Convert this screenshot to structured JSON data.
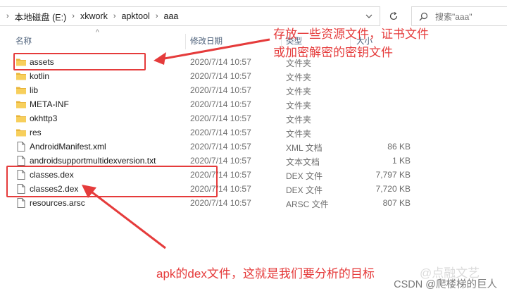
{
  "address_bar": {
    "crumbs": [
      "本地磁盘 (E:)",
      "xkwork",
      "apktool",
      "aaa"
    ],
    "search_placeholder": "搜索\"aaa\""
  },
  "columns": {
    "name": "名称",
    "date": "修改日期",
    "type": "类型",
    "size": "大小"
  },
  "files": [
    {
      "name": "assets",
      "date": "2020/7/14 10:57",
      "type": "文件夹",
      "size": "",
      "icon": "folder"
    },
    {
      "name": "kotlin",
      "date": "2020/7/14 10:57",
      "type": "文件夹",
      "size": "",
      "icon": "folder"
    },
    {
      "name": "lib",
      "date": "2020/7/14 10:57",
      "type": "文件夹",
      "size": "",
      "icon": "folder"
    },
    {
      "name": "META-INF",
      "date": "2020/7/14 10:57",
      "type": "文件夹",
      "size": "",
      "icon": "folder"
    },
    {
      "name": "okhttp3",
      "date": "2020/7/14 10:57",
      "type": "文件夹",
      "size": "",
      "icon": "folder"
    },
    {
      "name": "res",
      "date": "2020/7/14 10:57",
      "type": "文件夹",
      "size": "",
      "icon": "folder"
    },
    {
      "name": "AndroidManifest.xml",
      "date": "2020/7/14 10:57",
      "type": "XML 文档",
      "size": "86 KB",
      "icon": "file"
    },
    {
      "name": "androidsupportmultidexversion.txt",
      "date": "2020/7/14 10:57",
      "type": "文本文档",
      "size": "1 KB",
      "icon": "file"
    },
    {
      "name": "classes.dex",
      "date": "2020/7/14 10:57",
      "type": "DEX 文件",
      "size": "7,797 KB",
      "icon": "file"
    },
    {
      "name": "classes2.dex",
      "date": "2020/7/14 10:57",
      "type": "DEX 文件",
      "size": "7,720 KB",
      "icon": "file"
    },
    {
      "name": "resources.arsc",
      "date": "2020/7/14 10:57",
      "type": "ARSC 文件",
      "size": "807 KB",
      "icon": "file"
    }
  ],
  "annotations": {
    "top_line1": "存放一些资源文件，证书文件",
    "top_line2": "或加密解密的密钥文件",
    "bottom": "apk的dex文件，这就是我们要分析的目标"
  },
  "watermark": {
    "text": "CSDN @爬楼梯的巨人",
    "ghost": "@点融文艺"
  },
  "colors": {
    "annotation_red": "#e53b3b",
    "folder_yellow": "#f4c542",
    "header_text": "#4c607a"
  }
}
